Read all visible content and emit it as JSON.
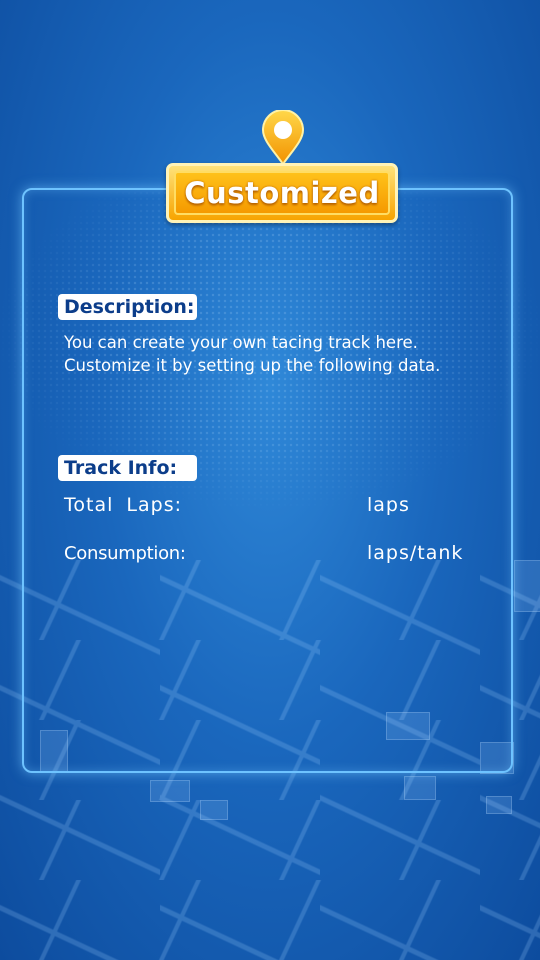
{
  "title": "Customized",
  "description": {
    "label": "Description:",
    "line1": "You can create your own tacing track here.",
    "line2": "Customize it by setting up the following data."
  },
  "track_info": {
    "label": "Track Info:",
    "total_laps_label": "Total  Laps:",
    "total_laps_unit": "laps",
    "consumption_label": "Consumption:",
    "consumption_unit": "laps/tank"
  },
  "icons": {
    "pin": "location-pin-icon"
  },
  "colors": {
    "background": "#1a67bd",
    "panel_border": "#6ec3ff",
    "badge_gold": "#f7a400",
    "tag_text": "#0c3d8a"
  }
}
